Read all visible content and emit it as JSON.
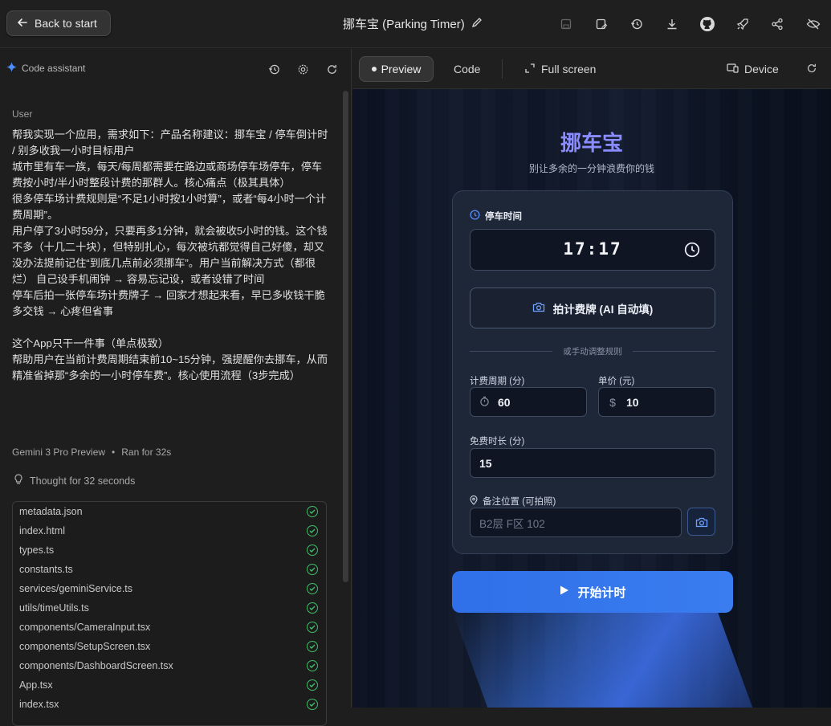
{
  "topbar": {
    "back_label": "Back to start",
    "app_title": "挪车宝 (Parking Timer)",
    "icons": [
      "save-disabled-icon",
      "save-as-icon",
      "history-icon",
      "download-icon",
      "github-icon",
      "deploy-rocket-icon",
      "share-icon",
      "hide-icon"
    ]
  },
  "assistant": {
    "title": "Code assistant",
    "user_label": "User",
    "user_message": [
      "帮我实现一个应用，需求如下：产品名称建议：挪车宝 / 停车倒计时 / 别多收我一小时目标用户",
      "城市里有车一族，每天/每周都需要在路边或商场停车场停车，停车费按小时/半小时整段计费的那群人。核心痛点（极其具体）",
      "很多停车场计费规则是“不足1小时按1小时算”，或者“每4小时一个计费周期”。",
      "用户停了3小时59分，只要再多1分钟，就会被收5小时的钱。这个钱不多（十几二十块），但特别扎心，每次被坑都觉得自己好傻，却又没办法提前记住“到底几点前必须挪车”。用户当前解决方式（都很烂） 自己设手机闹钟 → 容易忘记设，或者设错了时间",
      "停车后拍一张停车场计费牌子 → 回家才想起来看，早已多收钱干脆多交钱 → 心疼但省事",
      "",
      "这个App只干一件事（单点极致）",
      "帮助用户在当前计费周期结束前10~15分钟，强提醒你去挪车，从而精准省掉那“多余的一小时停车费”。核心使用流程（3步完成）"
    ],
    "model": "Gemini 3 Pro Preview",
    "ran_for": "Ran for 32s",
    "thought": "Thought for 32 seconds",
    "files": [
      "metadata.json",
      "index.html",
      "types.ts",
      "constants.ts",
      "services/geminiService.ts",
      "utils/timeUtils.ts",
      "components/CameraInput.tsx",
      "components/SetupScreen.tsx",
      "components/DashboardScreen.tsx",
      "App.tsx",
      "index.tsx"
    ]
  },
  "preview_toolbar": {
    "preview_label": "Preview",
    "code_label": "Code",
    "fullscreen_label": "Full screen",
    "device_label": "Device"
  },
  "app": {
    "title": "挪车宝",
    "subtitle": "别让多余的一分钟浪费你的钱",
    "parking_time_label": "停车时间",
    "parking_time_value": "17:17",
    "photo_button": "拍计费牌 (AI 自动填)",
    "divider_text": "或手动调整规则",
    "period_label": "计费周期 (分)",
    "period_value": "60",
    "price_label": "单价 (元)",
    "price_prefix": "$",
    "price_value": "10",
    "free_label": "免费时长 (分)",
    "free_value": "15",
    "note_label": "备注位置 (可拍照)",
    "note_placeholder": "B2层 F区 102",
    "start_button": "开始计时",
    "accent_color": "#8a8cff",
    "button_color": "#3a7df0"
  }
}
